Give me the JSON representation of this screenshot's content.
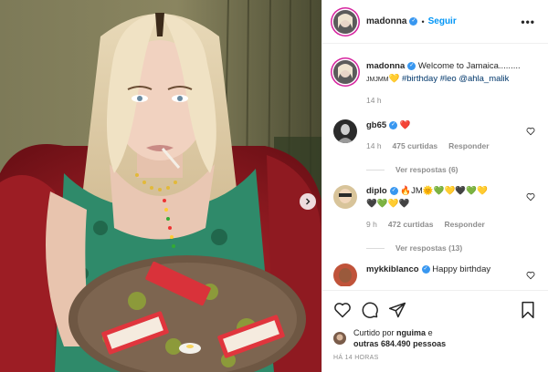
{
  "post": {
    "username": "madonna",
    "follow_label": "Seguir",
    "more_label": "•••",
    "verified_glyph": "✓",
    "dot_separator": "•"
  },
  "caption": {
    "username": "madonna",
    "text_1": "Welcome to Jamaica.........",
    "text_2": "JMJMM",
    "emoji": "💛",
    "hashtags": [
      "#birthday",
      "#leo"
    ],
    "mention": "@ahla_malik",
    "age": "14 h"
  },
  "comments": [
    {
      "username": "gb65",
      "text": "❤️",
      "age": "14 h",
      "likes_label": "475 curtidas",
      "reply_label": "Responder",
      "view_replies_label": "Ver respostas (6)"
    },
    {
      "username": "diplo",
      "text_line1": "🔥JM🌞💚💛🖤💚💛",
      "text_line2": "🖤💚💛🖤",
      "age": "9 h",
      "likes_label": "472 curtidas",
      "reply_label": "Responder",
      "view_replies_label": "Ver respostas (13)"
    },
    {
      "username": "mykkiblanco",
      "text": "Happy birthday"
    }
  ],
  "actions": {
    "like_icon": "heart-icon",
    "comment_icon": "comment-icon",
    "share_icon": "share-icon",
    "save_icon": "bookmark-icon"
  },
  "liked_by": {
    "prefix": "Curtido por",
    "user": "nguima",
    "and": "e",
    "others": "outras",
    "count": "684.490",
    "suffix": "pessoas"
  },
  "posted_time": "HÁ 14 HORAS",
  "colors": {
    "accent_blue": "#0095f6",
    "verified_blue": "#3897f0",
    "heart_red": "#ed4956",
    "muted": "#8e8e8e"
  }
}
